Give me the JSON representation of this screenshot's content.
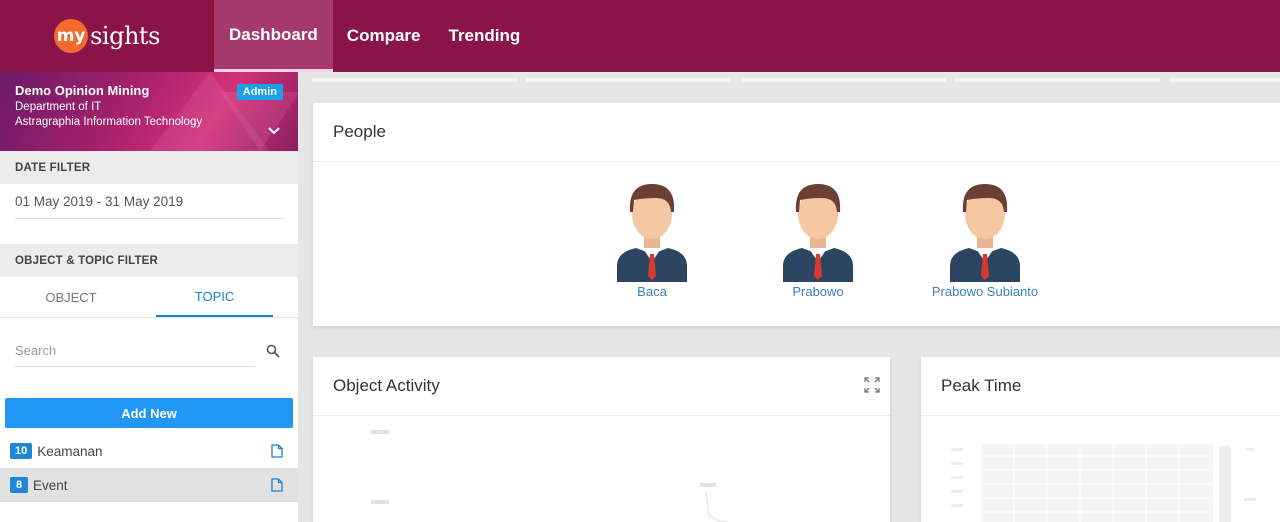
{
  "app": {
    "logo_badge": "my",
    "logo_text": "sights"
  },
  "nav": {
    "items": [
      {
        "label": "Dashboard",
        "active": true
      },
      {
        "label": "Compare",
        "active": false
      },
      {
        "label": "Trending",
        "active": false
      }
    ]
  },
  "org": {
    "title": "Demo Opinion Mining",
    "department": "Department of IT",
    "company": "Astragraphia Information Technology",
    "role_badge": "Admin"
  },
  "date_filter": {
    "heading": "DATE FILTER",
    "value": "01 May 2019 - 31 May 2019"
  },
  "topic_filter": {
    "heading": "OBJECT & TOPIC FILTER",
    "tabs": [
      {
        "label": "OBJECT",
        "active": false
      },
      {
        "label": "TOPIC",
        "active": true
      }
    ],
    "search_placeholder": "Search",
    "add_button": "Add New",
    "items": [
      {
        "count": "10",
        "label": "Keamanan",
        "selected": false
      },
      {
        "count": "8",
        "label": "Event",
        "selected": true
      }
    ]
  },
  "people_card": {
    "title": "People",
    "people": [
      {
        "name": "Baca"
      },
      {
        "name": "Prabowo"
      },
      {
        "name": "Prabowo Subianto"
      }
    ]
  },
  "object_activity_card": {
    "title": "Object Activity"
  },
  "peak_time_card": {
    "title": "Peak Time"
  },
  "colors": {
    "brand": "#8a1348",
    "accent": "#2196f3",
    "badge": "#1aa1e6"
  }
}
